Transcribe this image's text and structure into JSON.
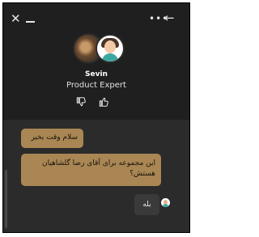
{
  "header": {
    "close_icon": "close-icon",
    "minimize_icon": "minimize-icon",
    "more_icon": "more-options-icon",
    "back_icon": "arrow-left-icon",
    "agent_name": "Sevin",
    "agent_title": "Product Expert",
    "thumbs_down_icon": "thumbs-down-icon",
    "thumbs_up_icon": "thumbs-up-icon"
  },
  "chat": {
    "messages": [
      {
        "from": "agent",
        "text": "سلام وقت بخیر"
      },
      {
        "from": "agent",
        "text": "این مجموعه برای آقای رضا گلشاهیان هستش؟"
      },
      {
        "from": "user",
        "text": "بله"
      }
    ]
  },
  "colors": {
    "background": "#1f1f1f",
    "chat_background": "#2b2b2b",
    "agent_bubble": "#a98654",
    "user_bubble": "#3a3a3a"
  }
}
